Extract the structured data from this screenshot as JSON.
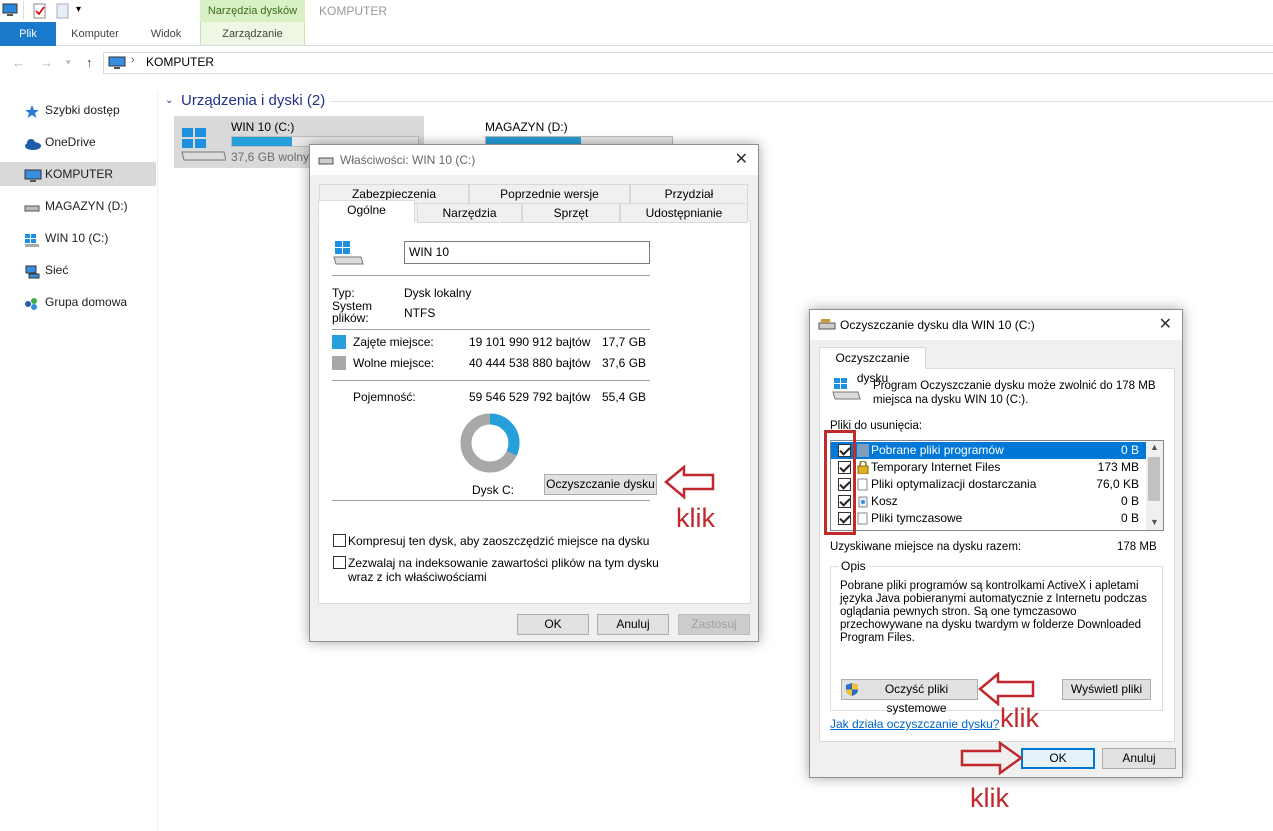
{
  "ribbon": {
    "tabs": [
      "Plik",
      "Komputer",
      "Widok"
    ],
    "context_group": "Narzędzia dysków",
    "context_tab": "Zarządzanie",
    "window_title": "KOMPUTER"
  },
  "address": {
    "path": "KOMPUTER"
  },
  "sidebar": {
    "items": [
      {
        "label": "Szybki dostęp",
        "icon": "star-icon"
      },
      {
        "label": "OneDrive",
        "icon": "cloud-icon"
      },
      {
        "label": "KOMPUTER",
        "icon": "computer-icon",
        "selected": true
      },
      {
        "label": "MAGAZYN (D:)",
        "icon": "drive-icon"
      },
      {
        "label": "WIN 10 (C:)",
        "icon": "windows-drive-icon"
      },
      {
        "label": "Sieć",
        "icon": "network-icon"
      },
      {
        "label": "Grupa domowa",
        "icon": "homegroup-icon"
      }
    ]
  },
  "main": {
    "group_header": "Urządzenia i dyski (2)",
    "drives": [
      {
        "name": "WIN 10 (C:)",
        "free": "37,6 GB wolnych",
        "used_fraction": 0.32
      },
      {
        "name": "MAGAZYN (D:)",
        "free": "",
        "used_fraction": 0.51
      }
    ]
  },
  "properties": {
    "title": "Właściwości: WIN 10 (C:)",
    "tabs_row1": [
      "Zabezpieczenia",
      "Poprzednie wersje",
      "Przydział"
    ],
    "tabs_row2": [
      "Ogólne",
      "Narzędzia",
      "Sprzęt",
      "Udostępnianie"
    ],
    "name_value": "WIN 10",
    "type_label": "Typ:",
    "type_value": "Dysk lokalny",
    "fs_label": "System plików:",
    "fs_value": "NTFS",
    "used_label": "Zajęte miejsce:",
    "used_bytes": "19 101 990 912 bajtów",
    "used_gb": "17,7 GB",
    "free_label": "Wolne miejsce:",
    "free_bytes": "40 444 538 880 bajtów",
    "free_gb": "37,6 GB",
    "capacity_label": "Pojemność:",
    "capacity_bytes": "59 546 529 792 bajtów",
    "capacity_gb": "55,4 GB",
    "used_fraction": 0.32,
    "disk_label": "Dysk C:",
    "cleanup_button": "Oczyszczanie dysku",
    "compress_label": "Kompresuj ten dysk, aby zaoszczędzić miejsce na dysku",
    "index_label_1": "Zezwalaj na indeksowanie zawartości plików na tym dysku",
    "index_label_2": "wraz z ich właściwościami",
    "ok": "OK",
    "cancel": "Anuluj",
    "apply": "Zastosuj",
    "colors": {
      "used": "#26a0da",
      "free": "#a8a8a8"
    }
  },
  "cleanup": {
    "title": "Oczyszczanie dysku dla WIN 10 (C:)",
    "tab": "Oczyszczanie dysku",
    "intro_1": "Program Oczyszczanie dysku może zwolnić do 178 MB",
    "intro_2": "miejsca na dysku WIN 10 (C:).",
    "files_label": "Pliki do usunięcia:",
    "files": [
      {
        "name": "Pobrane pliki programów",
        "size": "0 B",
        "checked": true,
        "selected": true
      },
      {
        "name": "Temporary Internet Files",
        "size": "173 MB",
        "checked": true
      },
      {
        "name": "Pliki optymalizacji dostarczania",
        "size": "76,0 KB",
        "checked": true
      },
      {
        "name": "Kosz",
        "size": "0 B",
        "checked": true
      },
      {
        "name": "Pliki tymczasowe",
        "size": "0 B",
        "checked": true
      }
    ],
    "total_label": "Uzyskiwane miejsce na dysku razem:",
    "total_value": "178 MB",
    "opis_label": "Opis",
    "description": "Pobrane pliki programów są kontrolkami ActiveX i apletami języka Java pobieranymi automatycznie z Internetu podczas oglądania pewnych stron. Są one tymczasowo przechowywane na dysku twardym w folderze Downloaded Program Files.",
    "system_button": "Oczyść pliki systemowe",
    "view_button": "Wyświetl pliki",
    "help_link": "Jak działa oczyszczanie dysku?",
    "ok": "OK",
    "cancel": "Anuluj"
  },
  "annotations": {
    "klik": "klik",
    "color": "#c0282d"
  }
}
